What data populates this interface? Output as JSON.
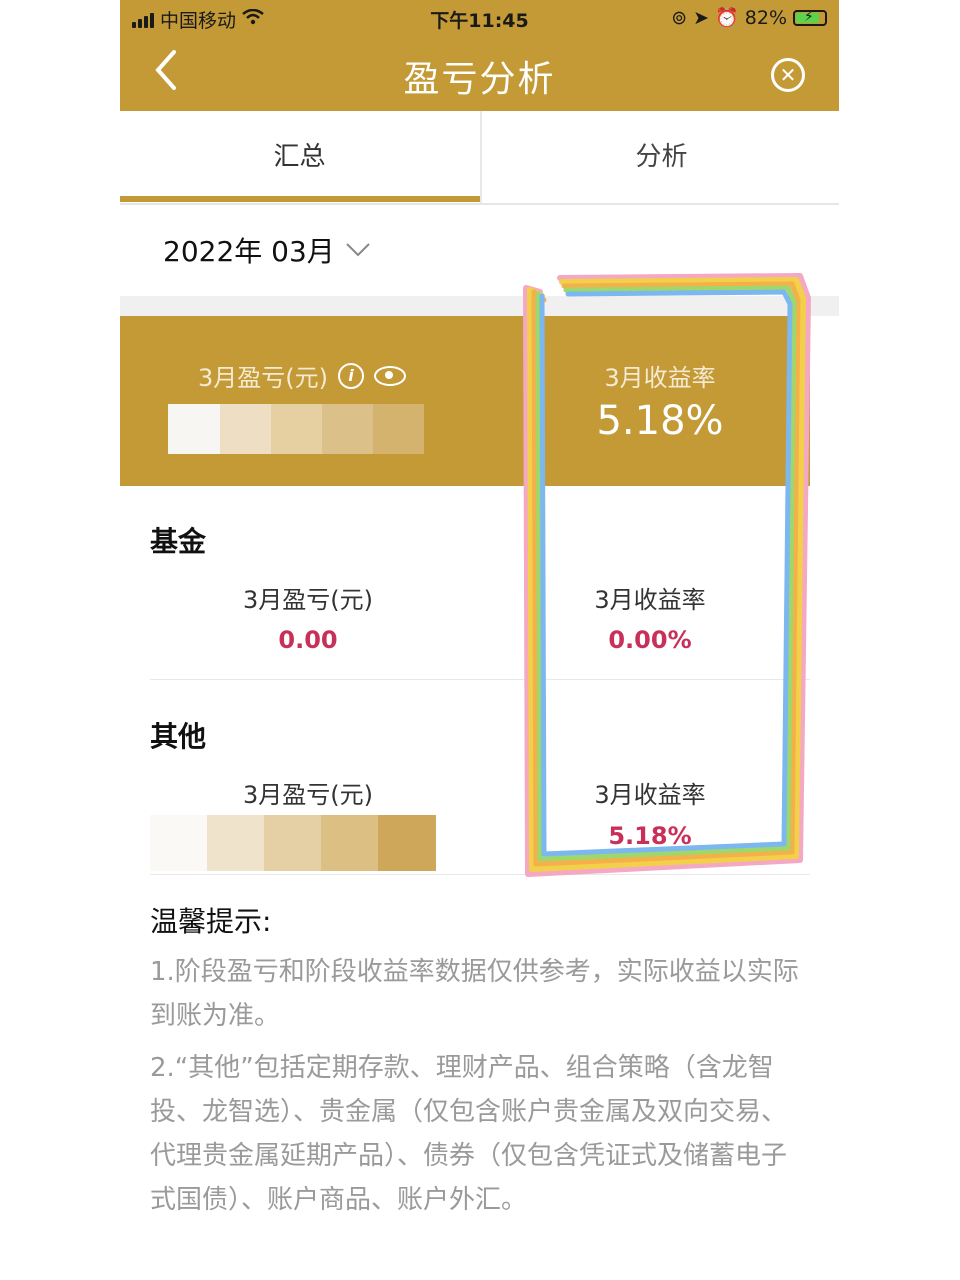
{
  "status_bar": {
    "carrier": "中国移动",
    "time": "下午11:45",
    "battery": "82%"
  },
  "nav": {
    "back_icon": "chevron-left-icon",
    "title": "盈亏分析",
    "close_icon": "close-circle-icon"
  },
  "tabs": [
    {
      "label": "汇总",
      "active": true
    },
    {
      "label": "分析",
      "active": false
    }
  ],
  "month_picker": {
    "value": "2022年 03月"
  },
  "summary": {
    "profit_label": "3月盈亏(元)",
    "rate_label": "3月收益率",
    "rate_value": "5.18%"
  },
  "sections": [
    {
      "title": "基金",
      "profit_label": "3月盈亏(元)",
      "profit_value": "0.00",
      "rate_label": "3月收益率",
      "rate_value": "0.00%"
    },
    {
      "title": "其他",
      "profit_label": "3月盈亏(元)",
      "rate_label": "3月收益率",
      "rate_value": "5.18%"
    }
  ],
  "tips": {
    "title": "温馨提示:",
    "items": [
      "1.阶段盈亏和阶段收益率数据仅供参考，实际收益以实际到账为准。",
      "2.“其他”包括定期存款、理财产品、组合策略（含龙智投、龙智选）、贵金属（仅包含账户贵金属及双向交易、代理贵金属延期产品）、债券（仅包含凭证式及储蓄电子式国债）、账户商品、账户外汇。"
    ]
  },
  "colors": {
    "brand_gold": "#c49a36",
    "value_red": "#c8305a",
    "tip_gray": "#9a9a9a"
  }
}
